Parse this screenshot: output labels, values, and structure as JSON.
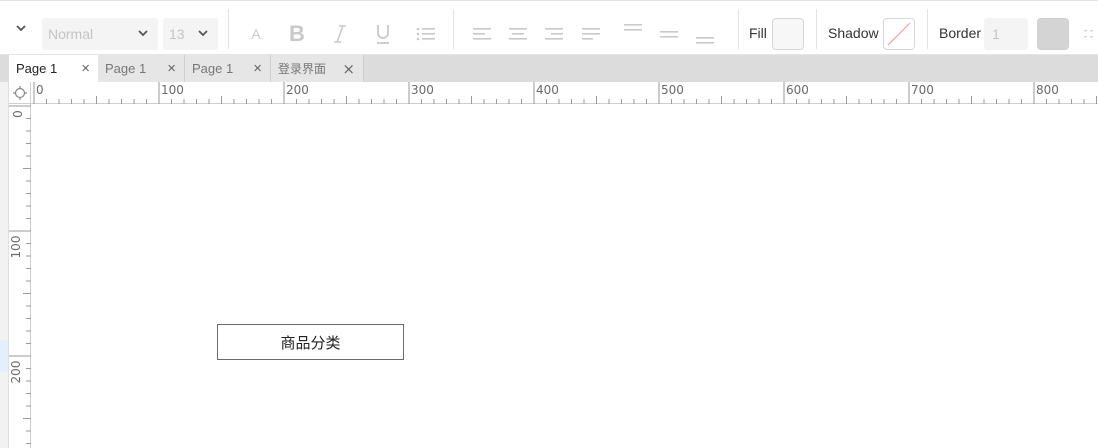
{
  "toolbar": {
    "font_weight": "Normal",
    "font_size": "13",
    "fill_label": "Fill",
    "shadow_label": "Shadow",
    "border_label": "Border",
    "border_width": "1",
    "format_icons": [
      "font-color-icon",
      "bold-icon",
      "italic-icon",
      "underline-icon",
      "list-icon"
    ],
    "align_icons": [
      "align-left-icon",
      "align-center-icon",
      "align-right-icon",
      "justify-icon",
      "valign-top-icon",
      "valign-middle-icon",
      "valign-bottom-icon"
    ]
  },
  "tabs": [
    {
      "label": "Page 1",
      "active": true
    },
    {
      "label": "Page 1",
      "active": false
    },
    {
      "label": "Page 1",
      "active": false
    },
    {
      "label": "登录界面",
      "active": false
    }
  ],
  "close_glyph": "×",
  "ruler": {
    "h_labels": [
      "0",
      "100",
      "200",
      "300",
      "400",
      "500",
      "600",
      "700",
      "800"
    ],
    "v_labels": [
      "0",
      "100",
      "200"
    ]
  },
  "canvas": {
    "widget_text": "商品分类"
  },
  "colors": {
    "toolbar_bg": "#ffffff",
    "tabbar_bg": "#dcdcdc",
    "shadow_slash": "#f0a0a0"
  }
}
